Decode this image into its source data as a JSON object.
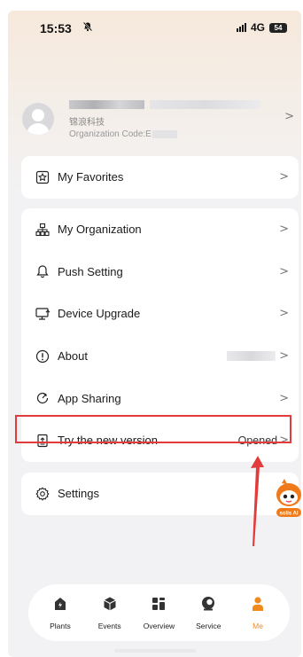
{
  "status_bar": {
    "time": "15:53",
    "mute_icon": "bell-slash-icon",
    "network": "4G",
    "battery": "54"
  },
  "profile": {
    "company": "锦浪科技",
    "org_code_label": "Organization Code:E"
  },
  "menu": {
    "favorites": {
      "label": "My Favorites",
      "icon": "star-badge-icon"
    },
    "group": [
      {
        "label": "My Organization",
        "icon": "org-tree-icon"
      },
      {
        "label": "Push Setting",
        "icon": "bell-icon"
      },
      {
        "label": "Device Upgrade",
        "icon": "monitor-upgrade-icon"
      },
      {
        "label": "About",
        "icon": "info-icon"
      },
      {
        "label": "App Sharing",
        "icon": "share-icon"
      },
      {
        "label": "Try the new version",
        "icon": "phone-upgrade-icon",
        "value": "Opened"
      }
    ],
    "settings": {
      "label": "Settings",
      "icon": "gear-icon"
    }
  },
  "assistant": {
    "label": "solis AI"
  },
  "tabbar": {
    "tabs": [
      {
        "label": "Plants",
        "icon": "plant-icon"
      },
      {
        "label": "Events",
        "icon": "events-icon"
      },
      {
        "label": "Overview",
        "icon": "overview-icon"
      },
      {
        "label": "Service",
        "icon": "service-icon"
      },
      {
        "label": "Me",
        "icon": "person-icon",
        "active": true
      }
    ]
  },
  "colors": {
    "accent": "#f08a1c",
    "highlight_box": "#e23b3b",
    "arrow": "#e23b3b"
  }
}
